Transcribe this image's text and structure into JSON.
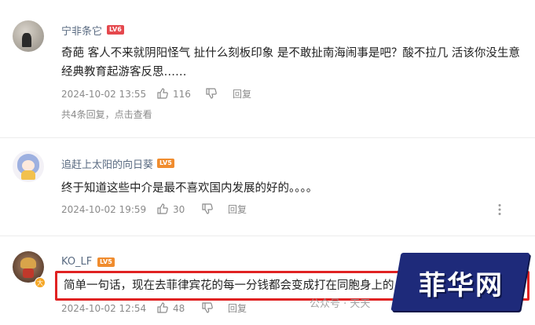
{
  "comments": [
    {
      "username": "宁非条它",
      "level": "LV6",
      "text": "奇葩 客人不来就阴阳怪气 扯什么刻板印象 是不敢扯南海闹事是吧？酸不拉几 活该你没生意 经典教育起游客反思……",
      "date": "2024-10-02 13:55",
      "likes": "116",
      "reply_label": "回复",
      "replies_summary": "共4条回复，点击查看"
    },
    {
      "username": "追赶上太阳的向日葵",
      "level": "LV5",
      "text": "终于知道这些中介是最不喜欢国内发展的好的。。。。",
      "date": "2024-10-02 19:59",
      "likes": "30",
      "reply_label": "回复"
    },
    {
      "username": "KO_LF",
      "level": "LV5",
      "verified_badge": "大",
      "text": "简单一句话，现在去菲律宾花的每一分钱都会变成打在同胞身上的",
      "date": "2024-10-02 12:54",
      "likes": "48",
      "reply_label": "回复"
    }
  ],
  "watermark": "公众号 · 天天",
  "logo_text": "菲华网",
  "colors": {
    "username": "#5a6b82",
    "lv6": "#e5484d",
    "lv5": "#f08c2e",
    "highlight": "#e02222",
    "logo_bg": "#1e2a7a"
  },
  "icons": [
    "thumbs-up-icon",
    "thumbs-down-icon",
    "more-icon"
  ]
}
